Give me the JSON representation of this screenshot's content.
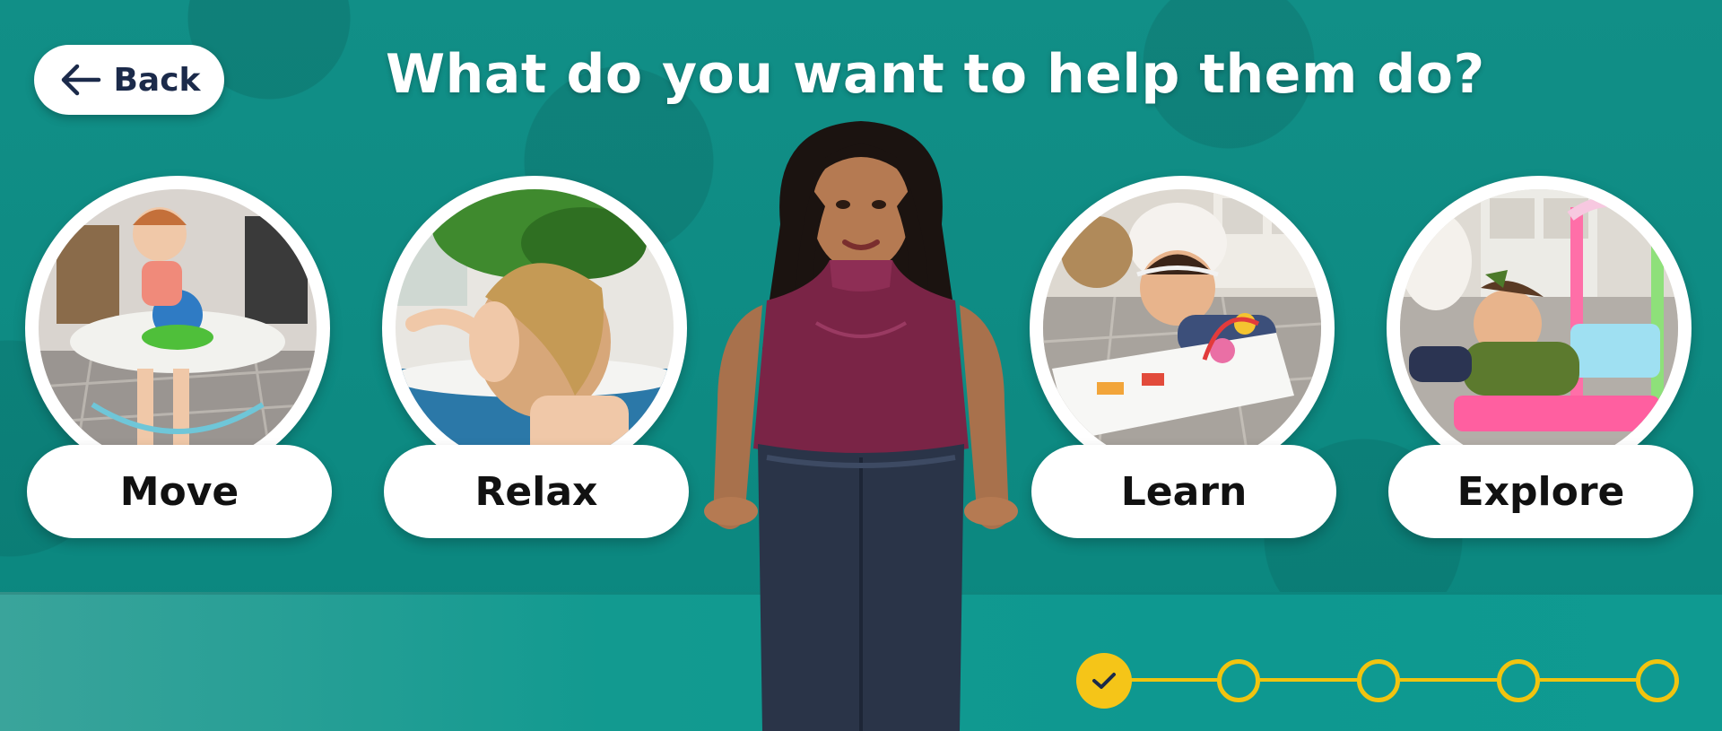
{
  "header": {
    "back_label": "Back",
    "title": "What do you want to help them do?"
  },
  "options": [
    {
      "label": "Move"
    },
    {
      "label": "Relax"
    },
    {
      "label": "Learn"
    },
    {
      "label": "Explore"
    }
  ],
  "progress": {
    "total_steps": 5,
    "completed_steps": 1
  },
  "colors": {
    "background": "#0f8f86",
    "accent": "#f5c518",
    "button_text": "#1b2a4a"
  },
  "icons": {
    "back": "arrow-left-icon",
    "done": "checkmark-icon"
  }
}
